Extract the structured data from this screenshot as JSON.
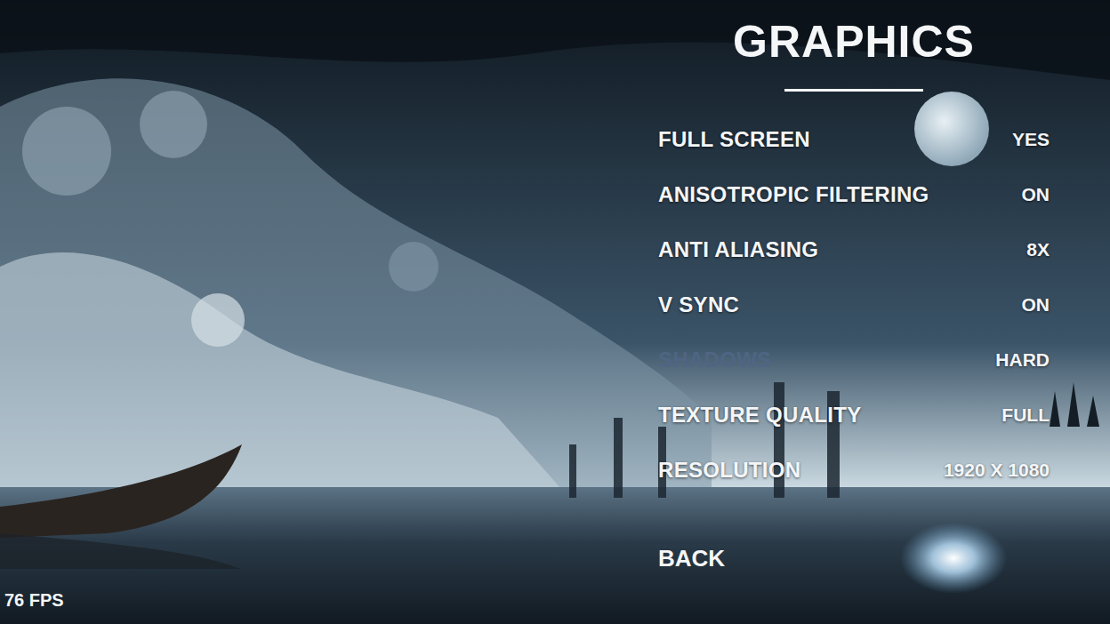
{
  "title": "GRAPHICS",
  "settings": [
    {
      "label": "FULL SCREEN",
      "value": "YES",
      "dimmed": false
    },
    {
      "label": "ANISOTROPIC FILTERING",
      "value": "ON",
      "dimmed": false
    },
    {
      "label": "ANTI ALIASING",
      "value": "8X",
      "dimmed": false
    },
    {
      "label": "V SYNC",
      "value": "ON",
      "dimmed": false
    },
    {
      "label": "SHADOWS",
      "value": "HARD",
      "dimmed": true
    },
    {
      "label": "TEXTURE QUALITY",
      "value": "FULL",
      "dimmed": false
    },
    {
      "label": "RESOLUTION",
      "value": "1920 X 1080",
      "dimmed": false
    }
  ],
  "back": "BACK",
  "fps": "76 FPS"
}
